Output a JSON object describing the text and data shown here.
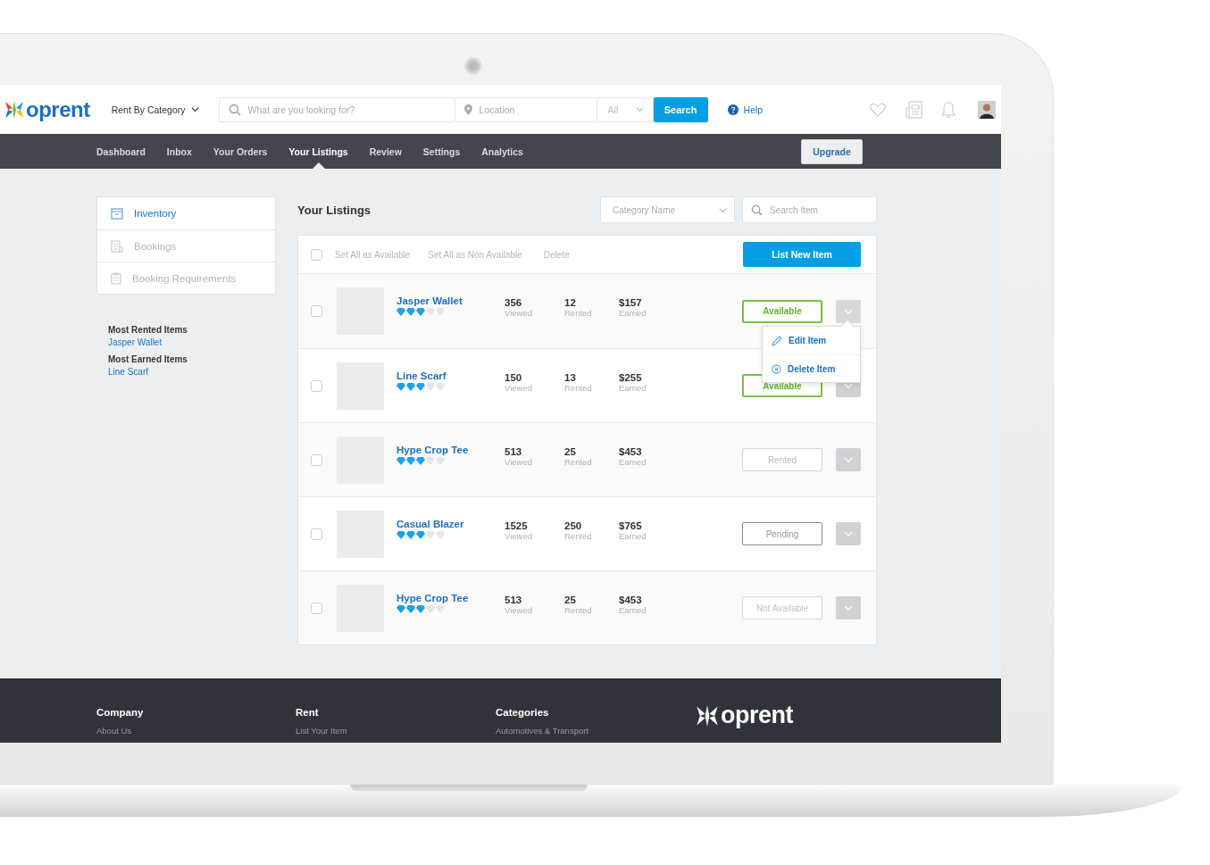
{
  "header": {
    "logo": "oprent",
    "category_menu": "Rent By Category",
    "search": {
      "placeholder": "What are you looking for?"
    },
    "location": {
      "placeholder": "Location"
    },
    "scope": "All",
    "search_button": "Search",
    "help": "Help"
  },
  "nav": {
    "items": [
      {
        "label": "Dashboard",
        "selected": false
      },
      {
        "label": "Inbox",
        "selected": false
      },
      {
        "label": "Your Orders",
        "selected": false
      },
      {
        "label": "Your Listings",
        "selected": true
      },
      {
        "label": "Review",
        "selected": false
      },
      {
        "label": "Settings",
        "selected": false
      },
      {
        "label": "Analytics",
        "selected": false
      }
    ],
    "upgrade": "Upgrade"
  },
  "sidebar": {
    "items": [
      {
        "label": "Inventory",
        "selected": true
      },
      {
        "label": "Bookings",
        "selected": false
      },
      {
        "label": "Booking Requirements",
        "selected": false
      }
    ],
    "highlights": [
      {
        "title": "Most Rented Items",
        "link": "Jasper Wallet"
      },
      {
        "title": "Most Earned Items",
        "link": "Line Scarf"
      }
    ]
  },
  "listings": {
    "title": "Your Listings",
    "category_filter": {
      "placeholder": "Category Name"
    },
    "search": {
      "placeholder": "Search Item"
    },
    "toolbar": {
      "checked": false,
      "actions": [
        "Set All as Available",
        "Set All as Non Available",
        "Delete"
      ],
      "new_button": "List New Item"
    },
    "row_menu": [
      "Edit Item",
      "Delete Item"
    ],
    "rows": [
      {
        "name": "Jasper Wallet",
        "stars": 3,
        "checked": false,
        "stats": [
          {
            "value": "356",
            "label": "Viewed"
          },
          {
            "value": "12",
            "label": "Rented"
          },
          {
            "value": "$157",
            "label": "Earned"
          }
        ],
        "status": {
          "label": "Available",
          "kind": "available"
        },
        "menu_open": true
      },
      {
        "name": "Line Scarf",
        "stars": 3,
        "checked": false,
        "stats": [
          {
            "value": "150",
            "label": "Viewed"
          },
          {
            "value": "13",
            "label": "Rented"
          },
          {
            "value": "$255",
            "label": "Earned"
          }
        ],
        "status": {
          "label": "Available",
          "kind": "available"
        },
        "menu_open": false
      },
      {
        "name": "Hype Crop Tee",
        "stars": 3,
        "checked": false,
        "stats": [
          {
            "value": "513",
            "label": "Viewed"
          },
          {
            "value": "25",
            "label": "Rented"
          },
          {
            "value": "$453",
            "label": "Earned"
          }
        ],
        "status": {
          "label": "Rented",
          "kind": "rented"
        },
        "menu_open": false
      },
      {
        "name": "Casual Blazer",
        "stars": 3,
        "checked": false,
        "stats": [
          {
            "value": "1525",
            "label": "Viewed"
          },
          {
            "value": "250",
            "label": "Rented"
          },
          {
            "value": "$765",
            "label": "Earned"
          }
        ],
        "status": {
          "label": "Pending",
          "kind": "pending"
        },
        "menu_open": false
      },
      {
        "name": "Hype Crop Tee",
        "stars": 3,
        "checked": false,
        "stats": [
          {
            "value": "513",
            "label": "Viewed"
          },
          {
            "value": "25",
            "label": "Rented"
          },
          {
            "value": "$453",
            "label": "Earned"
          }
        ],
        "status": {
          "label": "Not Available",
          "kind": "not_available"
        },
        "menu_open": false
      }
    ]
  },
  "footer": {
    "columns": [
      {
        "title": "Company",
        "link": "About Us"
      },
      {
        "title": "Rent",
        "link": "List Your Item"
      },
      {
        "title": "Categories",
        "link": "Automotives & Transport"
      }
    ],
    "logo": "oprent"
  }
}
